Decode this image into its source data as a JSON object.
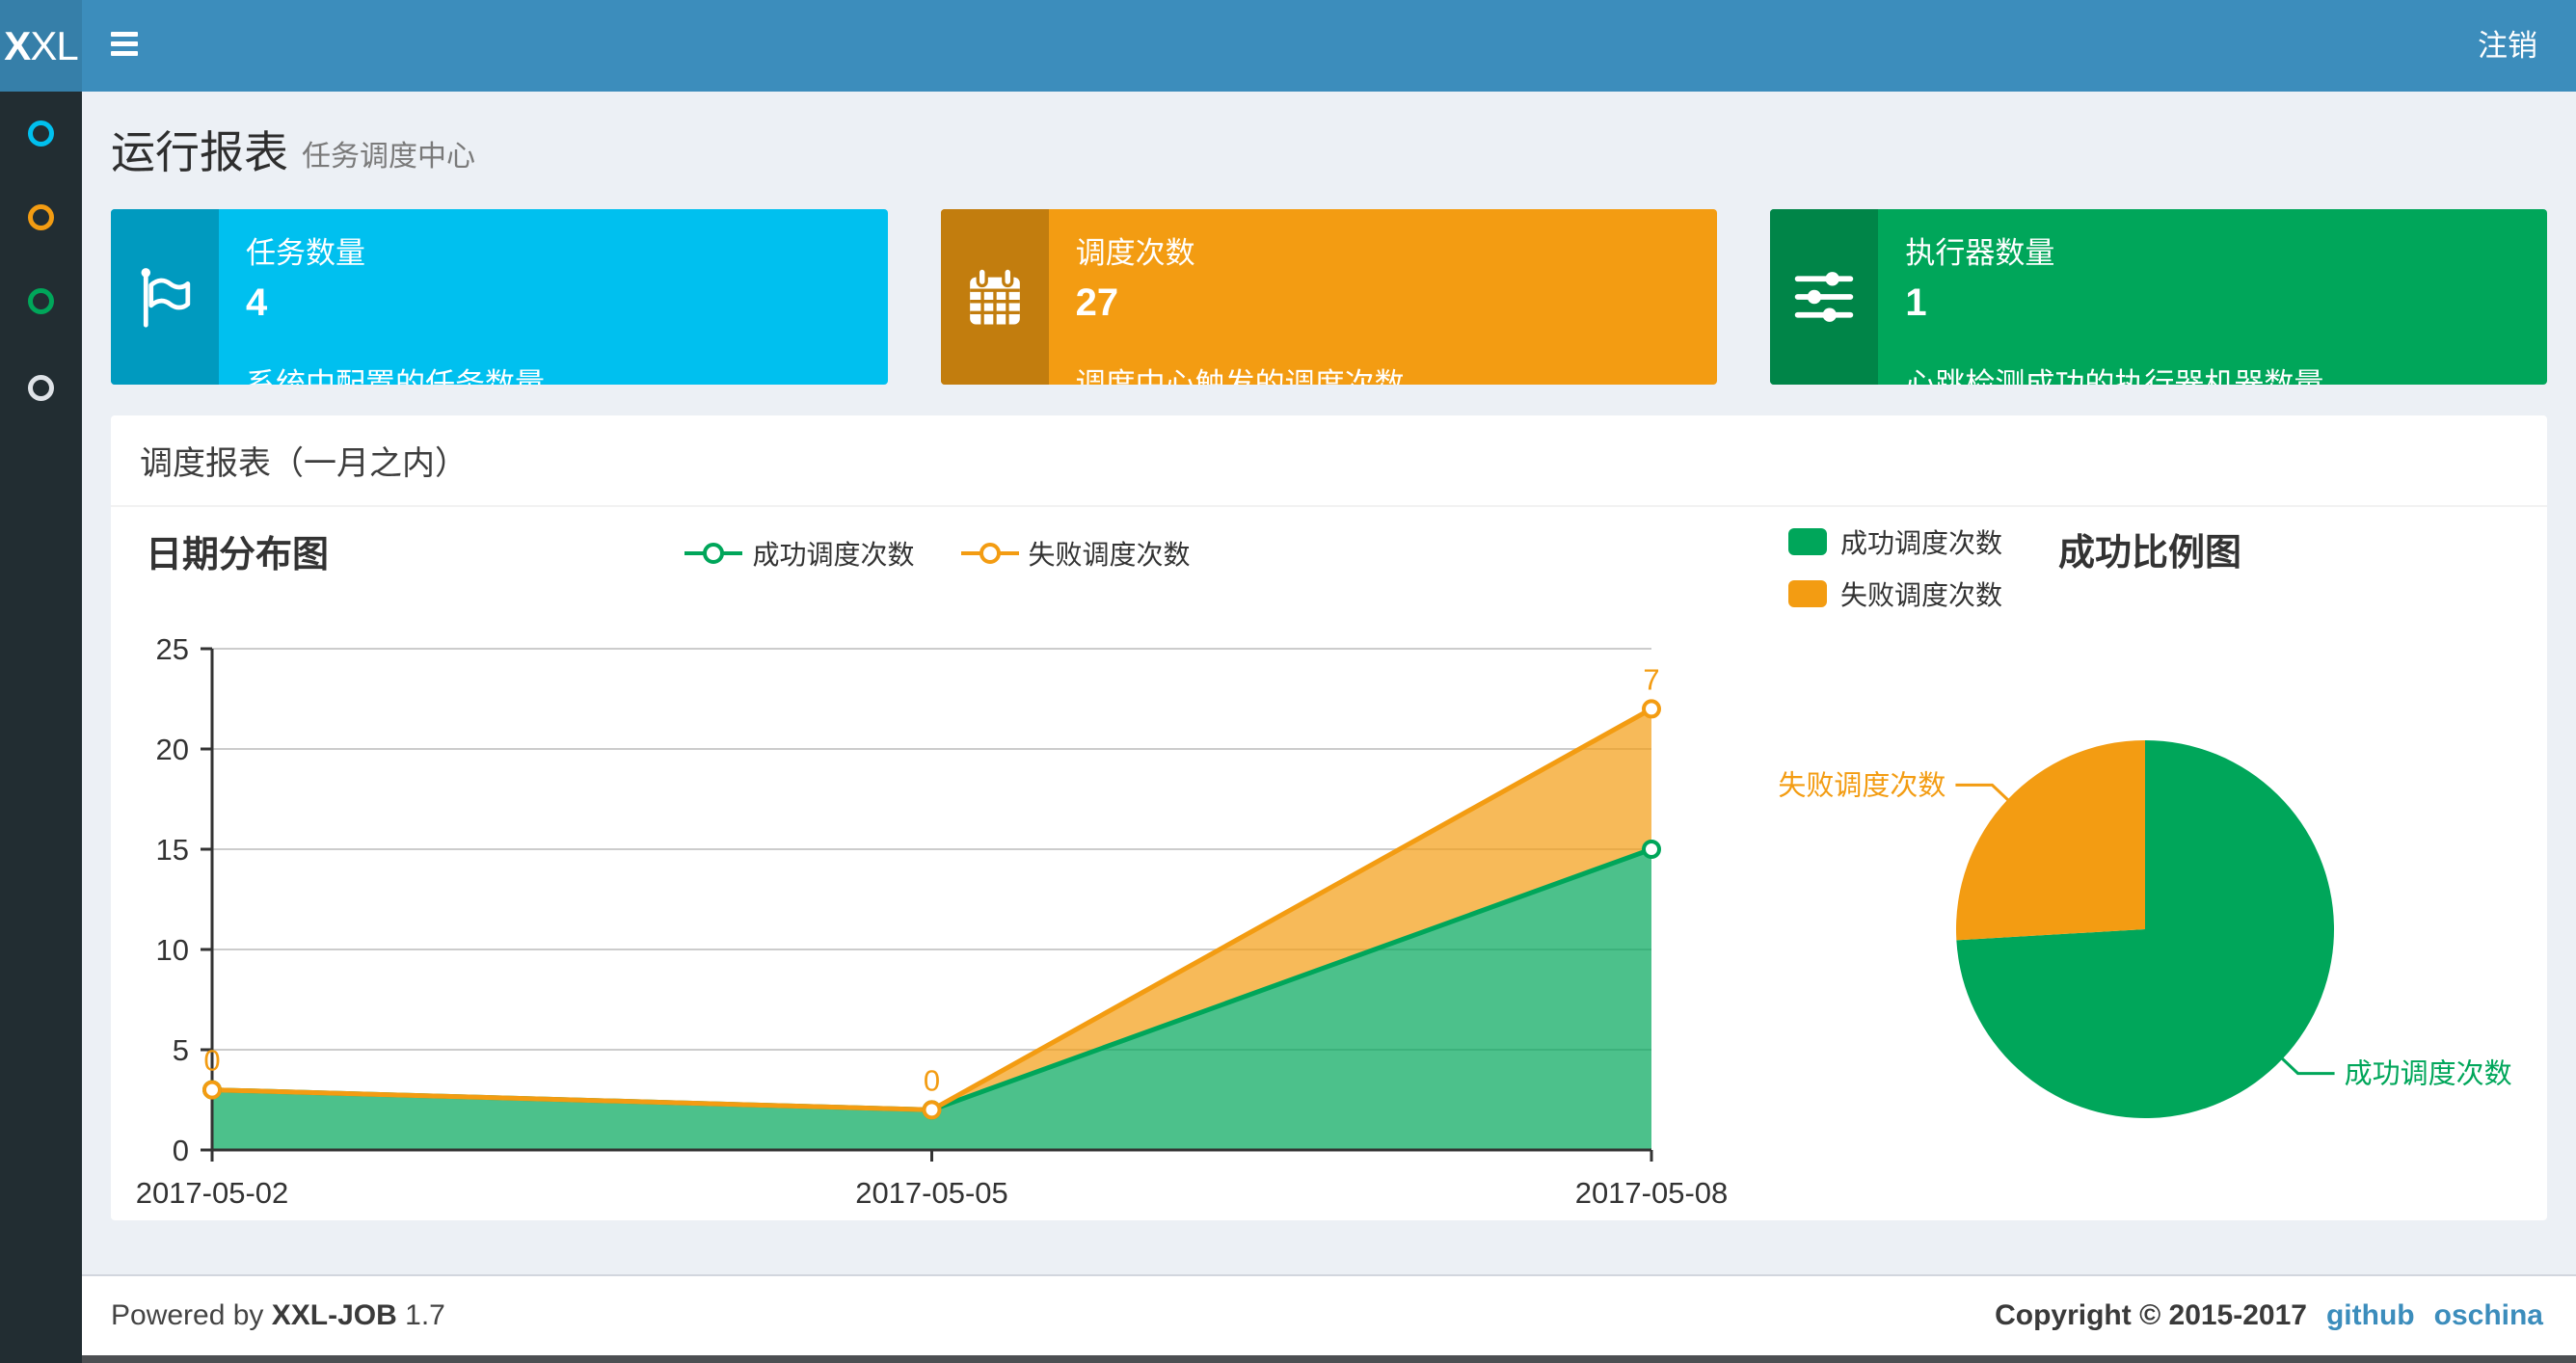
{
  "navbar": {
    "logo": "XXL",
    "logout": "注销",
    "accent_color": "#3c8dbc"
  },
  "sidebar": {
    "items": [
      {
        "icon": "circle-icon",
        "color": "#00c0ef"
      },
      {
        "icon": "circle-icon",
        "color": "#f39c12"
      },
      {
        "icon": "circle-icon",
        "color": "#00a65a"
      },
      {
        "icon": "circle-icon",
        "color": "#dfe3e8"
      }
    ]
  },
  "page": {
    "title": "运行报表",
    "subtitle": "任务调度中心"
  },
  "cards": [
    {
      "title": "任务数量",
      "value": "4",
      "desc": "系统中配置的任务数量",
      "color": "#00c0ef",
      "icon_bg": "#009abf",
      "icon": "flag-icon"
    },
    {
      "title": "调度次数",
      "value": "27",
      "desc": "调度中心触发的调度次数",
      "color": "#f39c12",
      "icon_bg": "#c27d0e",
      "icon": "calendar-icon"
    },
    {
      "title": "执行器数量",
      "value": "1",
      "desc": "心跳检测成功的执行器机器数量",
      "color": "#00a65a",
      "icon_bg": "#008548",
      "icon": "sliders-icon"
    }
  ],
  "panel": {
    "title": "调度报表（一月之内）"
  },
  "chart_data": [
    {
      "type": "area",
      "title": "日期分布图",
      "x": [
        "2017-05-02",
        "2017-05-05",
        "2017-05-08"
      ],
      "series": [
        {
          "name": "成功调度次数",
          "values": [
            3,
            2,
            15
          ],
          "color": "#00a65a"
        },
        {
          "name": "失败调度次数",
          "values": [
            0,
            0,
            7
          ],
          "color": "#f39c12",
          "labels": [
            "0",
            "0",
            "7"
          ]
        }
      ],
      "stacked": true,
      "ylim": [
        0,
        25
      ],
      "yticks": [
        0,
        5,
        10,
        15,
        20,
        25
      ],
      "grid": true,
      "legend_position": "top-center"
    },
    {
      "type": "pie",
      "title": "成功比例图",
      "slices": [
        {
          "name": "成功调度次数",
          "value": 20,
          "color": "#00a65a"
        },
        {
          "name": "失败调度次数",
          "value": 7,
          "color": "#f39c12"
        }
      ],
      "legend_position": "top-left"
    }
  ],
  "footer": {
    "powered_prefix": "Powered by",
    "product": "XXL-JOB",
    "version": "1.7",
    "copyright": "Copyright © 2015-2017",
    "links": [
      "github",
      "oschina"
    ]
  }
}
